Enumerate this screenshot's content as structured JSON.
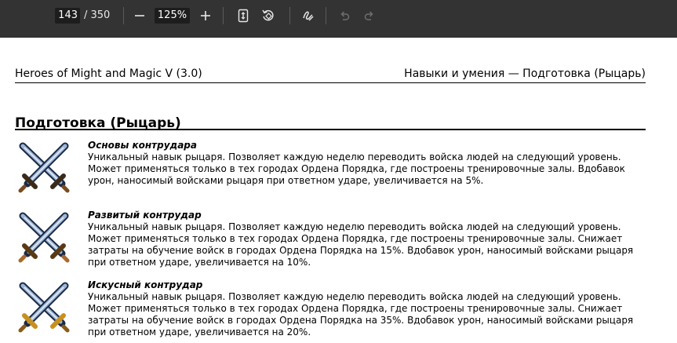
{
  "toolbar": {
    "page_current": "143",
    "page_total": "/ 350",
    "zoom": "125%",
    "icons": [
      "zoom-out-icon",
      "zoom-in-icon",
      "page-fit-icon",
      "rotate-icon",
      "draw-icon",
      "undo-icon",
      "redo-icon"
    ]
  },
  "document": {
    "header_left": "Heroes of Might and Magic V (3.0)",
    "header_right": "Навыки и умения — Подготовка (Рыцарь)",
    "section_title": "Подготовка (Рыцарь)",
    "skills": [
      {
        "name": "Основы контрудара",
        "description": "Уникальный навык рыцаря. Позволяет каждую неделю переводить войска людей на следующий уровень. Может применяться только в тех городах Ордена Порядка, где построены тренировочные залы. Вдобавок урон, наносимый войсками рыцаря при ответном ударе, увеличивается на 5%."
      },
      {
        "name": "Развитый контрудар",
        "description": "Уникальный навык рыцаря. Позволяет каждую неделю переводить войска людей на следующий уровень. Может применяться только в тех городах Ордена Порядка, где построены тренировочные залы. Снижает затраты на обучение войск в городах Ордена Порядка на 15%. Вдобавок урон, наносимый войсками рыцаря при ответном ударе, увеличивается на 10%."
      },
      {
        "name": "Искусный контрудар",
        "description": "Уникальный навык рыцаря. Позволяет каждую неделю переводить войска людей на следующий уровень. Может применяться только в тех городах Ордена Порядка, где построены тренировочные залы. Снижает затраты на обучение войск в городах Ордена Порядка на 35%. Вдобавок урон, наносимый войсками рыцаря при ответном ударе, увеличивается на 20%."
      }
    ]
  },
  "colors": {
    "toolbar_bg": "#333333",
    "input_bg": "#1d1d1d",
    "page_bg": "#ffffff",
    "icon_disabled": "#6e6e6e"
  }
}
